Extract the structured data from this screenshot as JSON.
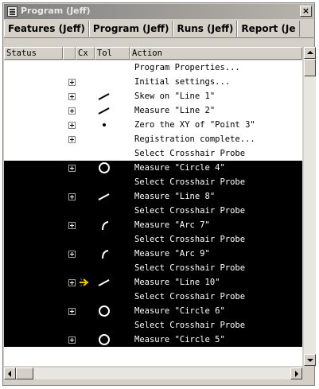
{
  "window": {
    "title": "Program (Jeff)",
    "close_label": "×"
  },
  "tabs": [
    {
      "label": "Features (Jeff)"
    },
    {
      "label": "Program (Jeff)"
    },
    {
      "label": "Runs (Jeff)"
    },
    {
      "label": "Report (Je"
    }
  ],
  "columns": {
    "status": "Status",
    "cx": "Cx",
    "tol": "Tol",
    "action": "Action"
  },
  "rows": [
    {
      "action": "Program Properties...",
      "expander": false,
      "icon": "none",
      "style": "light"
    },
    {
      "action": "Initial settings...",
      "expander": true,
      "icon": "none",
      "style": "light"
    },
    {
      "action": "Skew on \"Line 1\"",
      "expander": true,
      "icon": "line-icon",
      "style": "light"
    },
    {
      "action": "Measure \"Line 2\"",
      "expander": true,
      "icon": "line-icon",
      "style": "light"
    },
    {
      "action": "Zero the XY of \"Point 3\"",
      "expander": true,
      "icon": "point-icon",
      "style": "light"
    },
    {
      "action": "Registration complete...",
      "expander": true,
      "icon": "none",
      "style": "light"
    },
    {
      "action": "Select Crosshair Probe",
      "expander": false,
      "icon": "none",
      "style": "light"
    },
    {
      "action": "Measure \"Circle 4\"",
      "expander": true,
      "icon": "circle-icon",
      "style": "dark"
    },
    {
      "action": "Select Crosshair Probe",
      "expander": false,
      "icon": "none",
      "style": "dark"
    },
    {
      "action": "Measure \"Line 8\"",
      "expander": true,
      "icon": "line-icon",
      "style": "dark"
    },
    {
      "action": "Select Crosshair Probe",
      "expander": false,
      "icon": "none",
      "style": "dark"
    },
    {
      "action": "Measure \"Arc 7\"",
      "expander": true,
      "icon": "arc-icon",
      "style": "dark"
    },
    {
      "action": "Select Crosshair Probe",
      "expander": false,
      "icon": "none",
      "style": "dark"
    },
    {
      "action": "Measure \"Arc 9\"",
      "expander": true,
      "icon": "arc-icon",
      "style": "dark"
    },
    {
      "action": "Select Crosshair Probe",
      "expander": false,
      "icon": "none",
      "style": "dark"
    },
    {
      "action": "Measure \"Line 10\"",
      "expander": true,
      "icon": "line-icon",
      "style": "dark",
      "current_step": true
    },
    {
      "action": "Select Crosshair Probe",
      "expander": false,
      "icon": "none",
      "style": "dark"
    },
    {
      "action": "Measure \"Circle 6\"",
      "expander": true,
      "icon": "circle-icon",
      "style": "dark"
    },
    {
      "action": "Select Crosshair Probe",
      "expander": false,
      "icon": "none",
      "style": "dark"
    },
    {
      "action": "Measure \"Circle 5\"",
      "expander": true,
      "icon": "circle-icon",
      "style": "dark"
    }
  ],
  "colors": {
    "selection_bg": "#000000",
    "selection_fg": "#ffffff",
    "current_step_arrow": "#f0c000"
  }
}
